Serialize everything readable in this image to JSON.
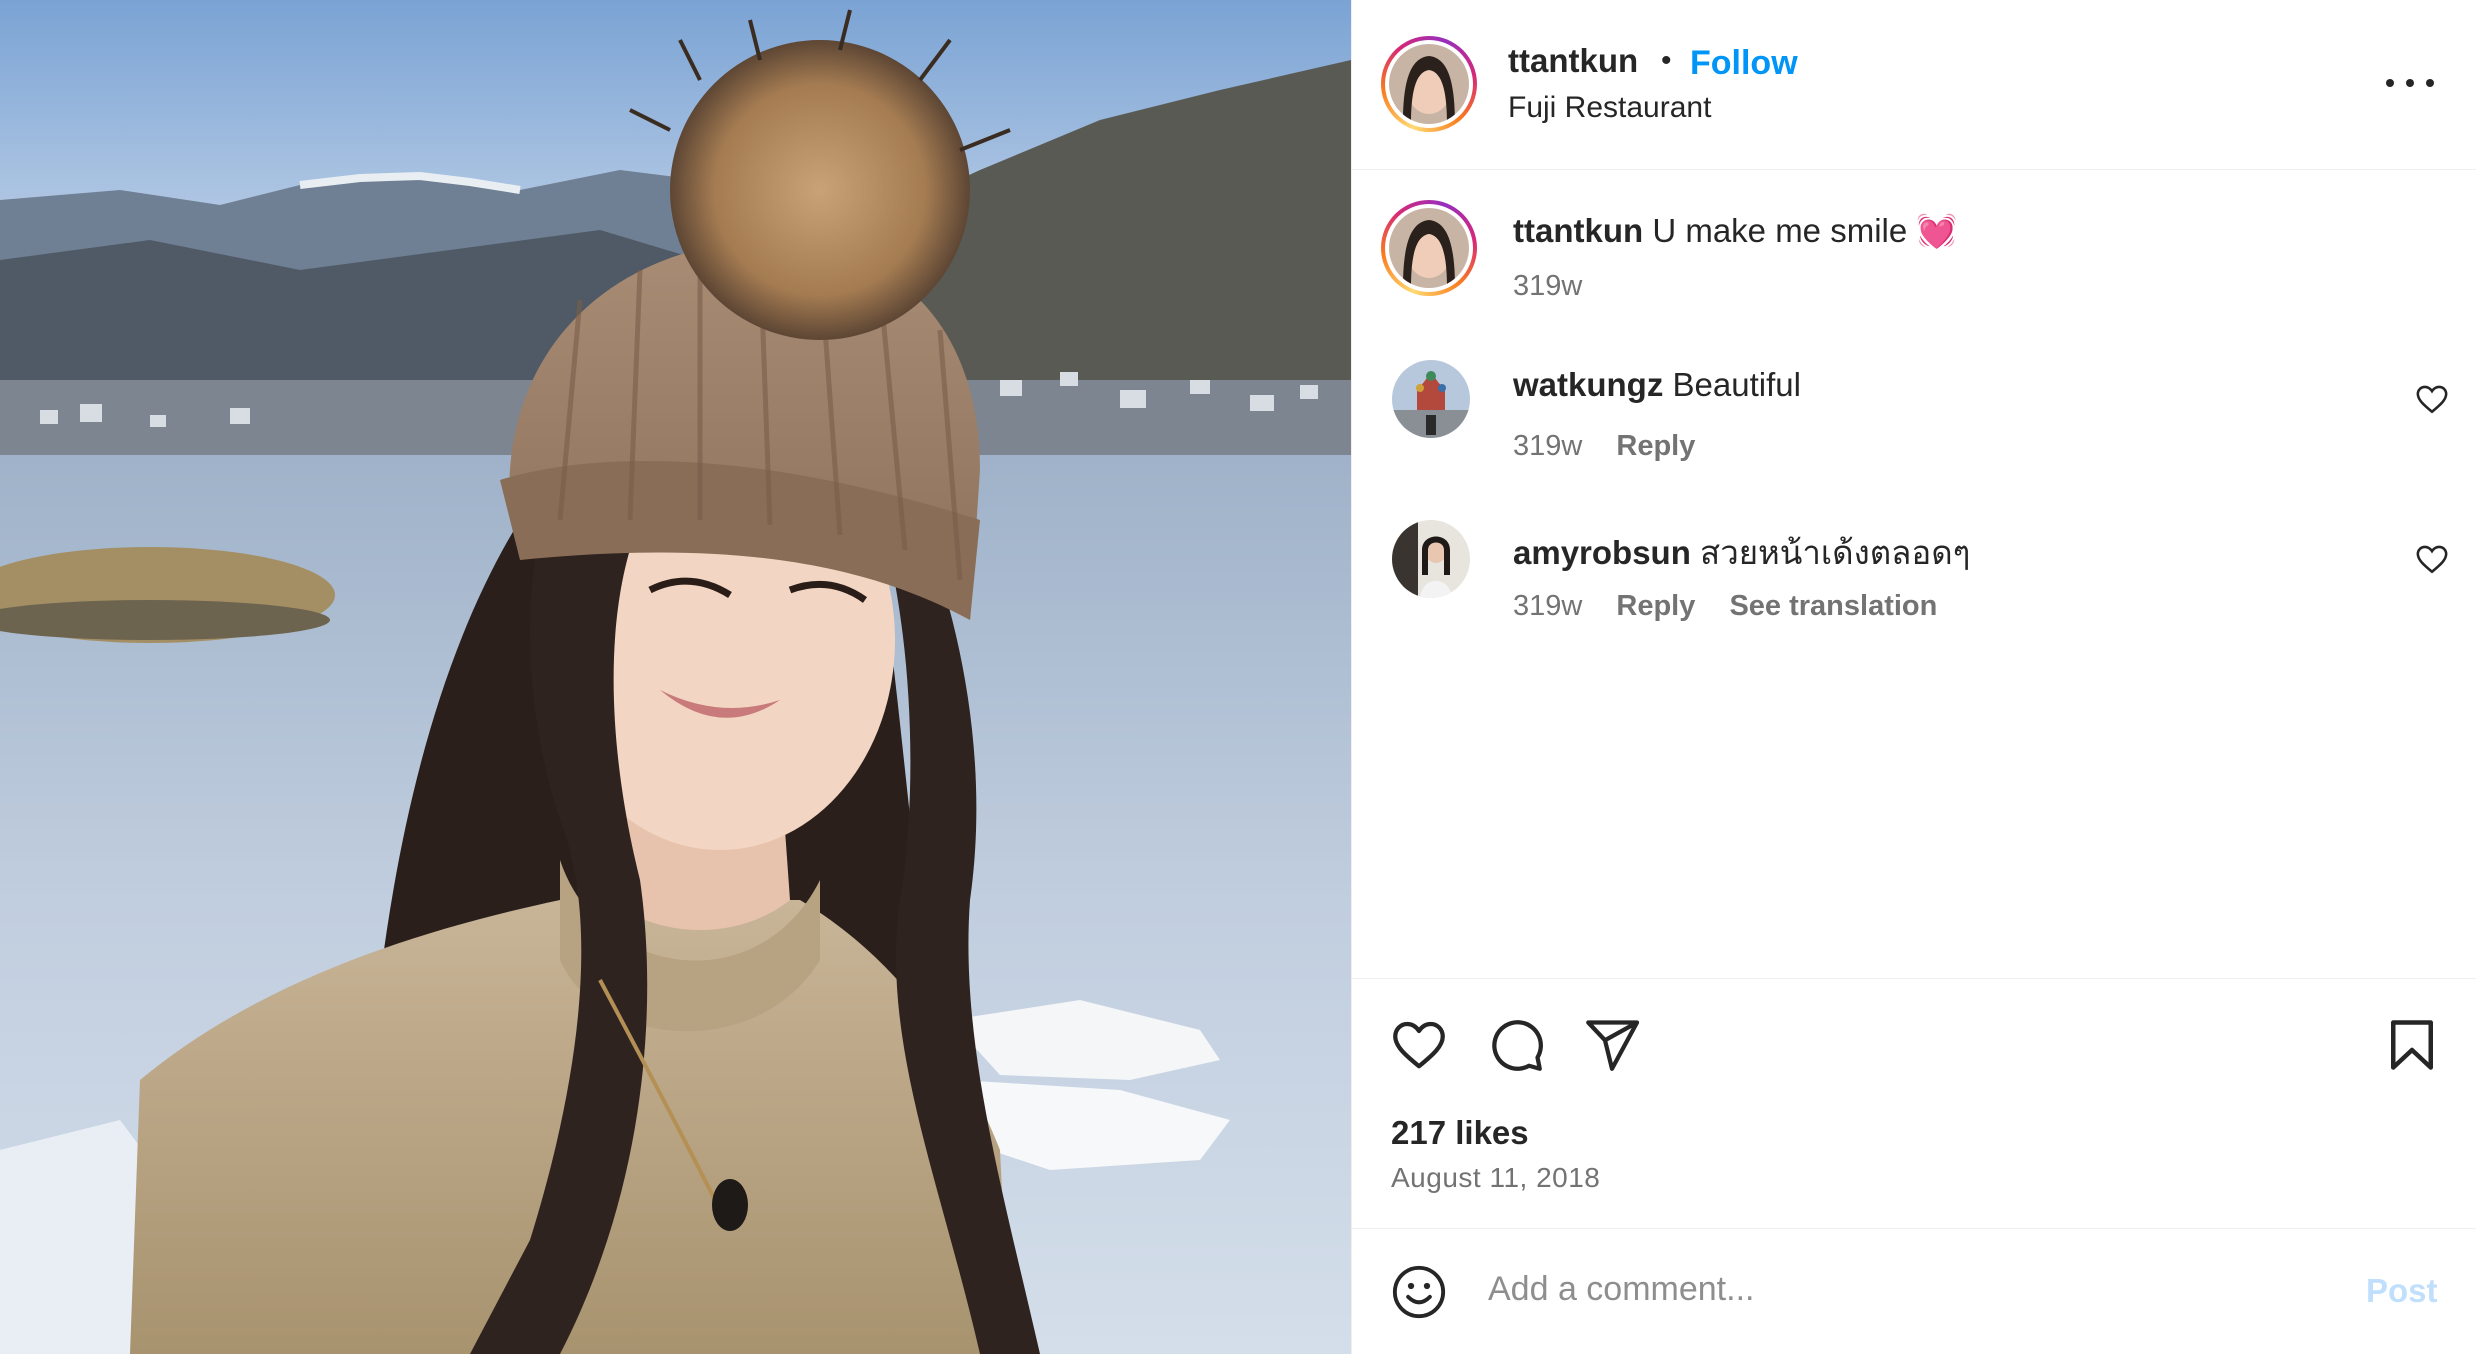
{
  "post": {
    "author": "ttantkun",
    "separator": "•",
    "follow_label": "Follow",
    "location": "Fuji Restaurant",
    "more_icon": "more-options-icon"
  },
  "comments": [
    {
      "username": "ttantkun",
      "text": "U make me smile 💓",
      "age": "319w",
      "reply": "",
      "translate": ""
    },
    {
      "username": "watkungz",
      "text": "Beautiful",
      "age": "319w",
      "reply": "Reply",
      "translate": ""
    },
    {
      "username": "amyrobsun",
      "text": "สวยหน้าเด้งตลอดๆ",
      "age": "319w",
      "reply": "Reply",
      "translate": "See translation"
    }
  ],
  "actions": {
    "icons": [
      "heart-icon",
      "comment-icon",
      "share-icon",
      "bookmark-icon"
    ],
    "likes": "217 likes",
    "date": "August 11, 2018"
  },
  "composer": {
    "placeholder": "Add a comment...",
    "post_label": "Post"
  },
  "colors": {
    "link": "#0095f6",
    "post_disabled": "#c0dffd",
    "secondary_text": "#737373"
  }
}
